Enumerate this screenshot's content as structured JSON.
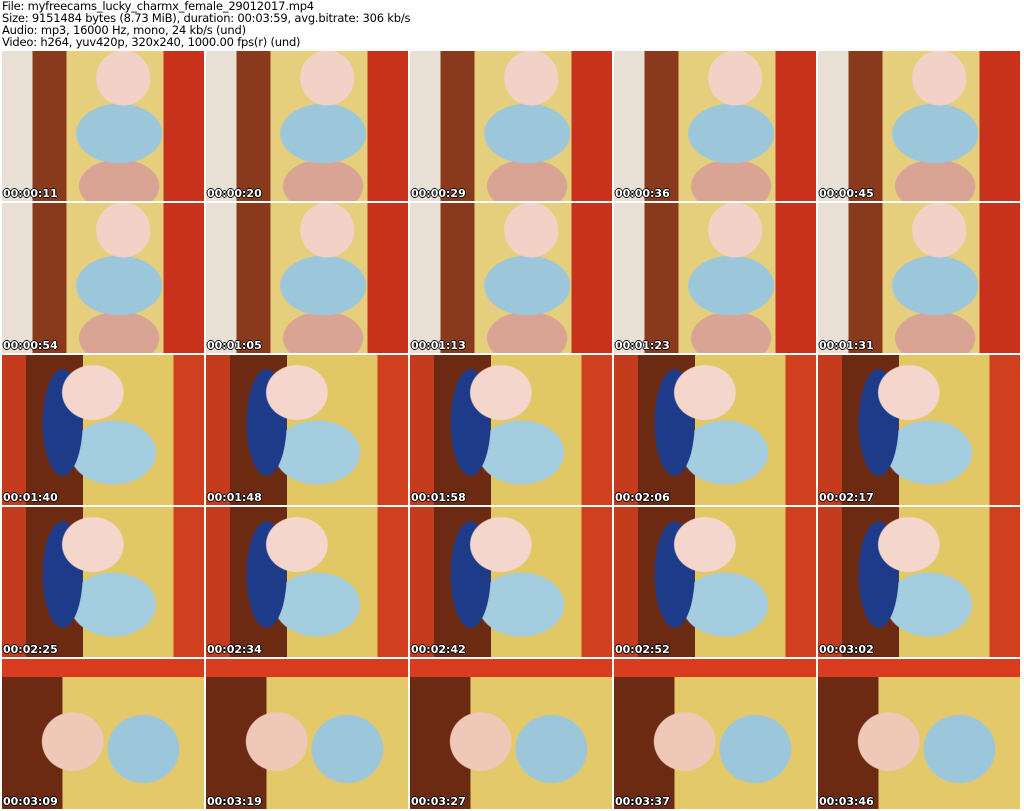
{
  "info": {
    "file": "File: myfreecams_lucky_charmx_female_29012017.mp4",
    "size": "Size: 9151484 bytes (8.73 MiB), duration: 00:03:59, avg.bitrate: 306 kb/s",
    "audio": "Audio: mp3, 16000 Hz, mono, 24 kb/s (und)",
    "video": "Video: h264, yuv420p, 320x240, 1000.00 fps(r) (und)"
  },
  "thumbnails": [
    "00:00:11",
    "00:00:20",
    "00:00:29",
    "00:00:36",
    "00:00:45",
    "00:00:54",
    "00:01:05",
    "00:01:13",
    "00:01:23",
    "00:01:31",
    "00:01:40",
    "00:01:48",
    "00:01:58",
    "00:02:06",
    "00:02:17",
    "00:02:25",
    "00:02:34",
    "00:02:42",
    "00:02:52",
    "00:03:02",
    "00:03:09",
    "00:03:19",
    "00:03:27",
    "00:03:37",
    "00:03:46"
  ]
}
